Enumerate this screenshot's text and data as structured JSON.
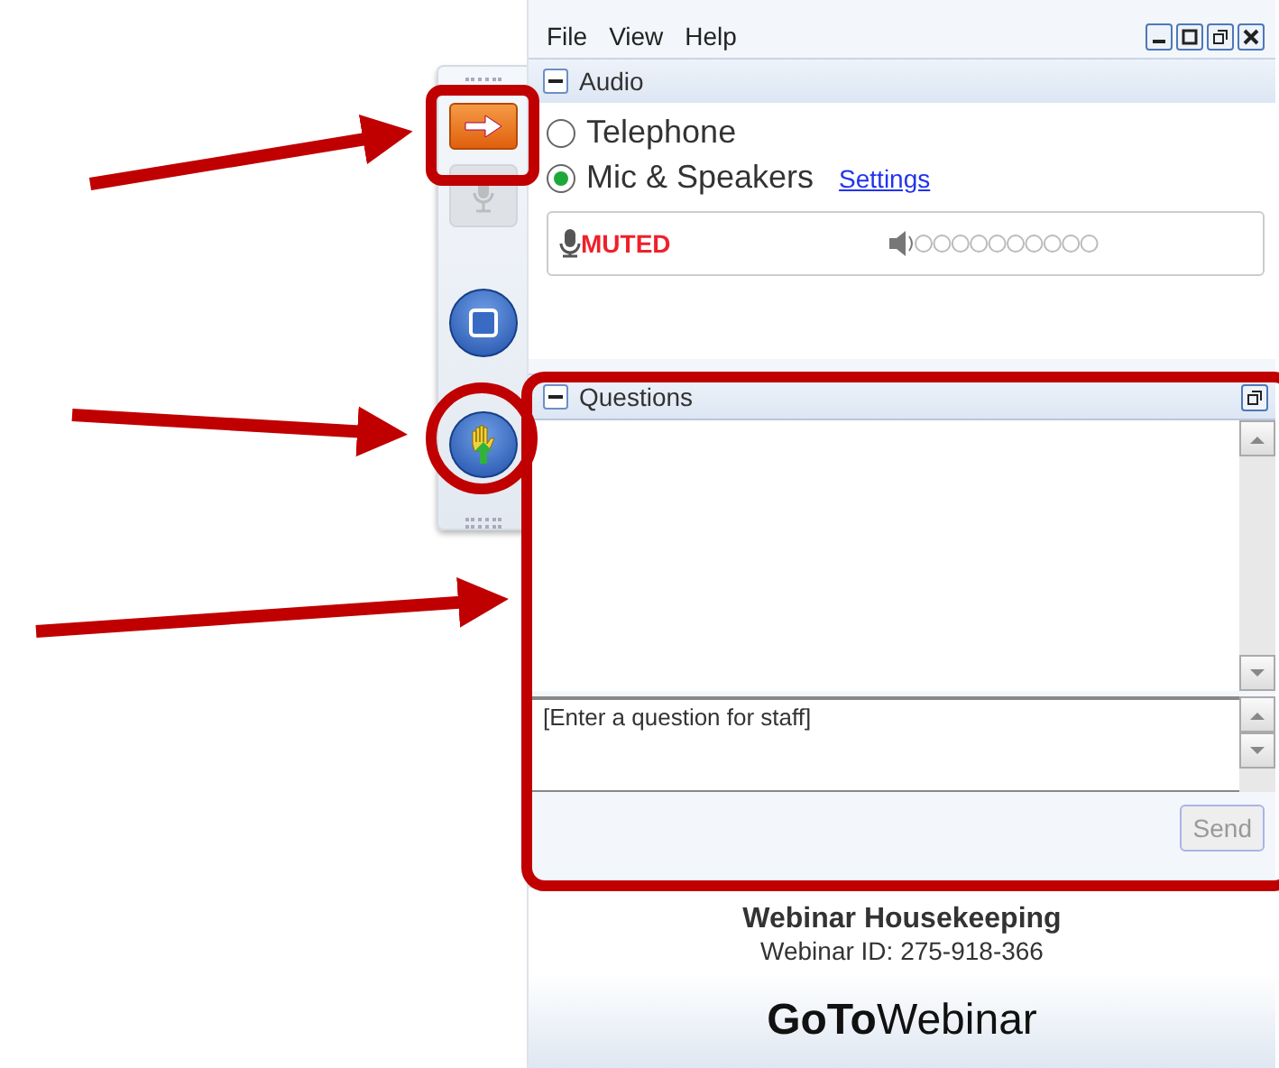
{
  "menu": [
    "File",
    "View",
    "Help"
  ],
  "side_tools": [
    {
      "kind": "exit",
      "disabled": false
    },
    {
      "kind": "mic",
      "disabled": true
    },
    {
      "kind": "stop",
      "disabled": false
    },
    {
      "kind": "hand",
      "disabled": false
    }
  ],
  "audio": {
    "title": "Audio",
    "options": [
      {
        "label": "Telephone",
        "selected": false
      },
      {
        "label": "Mic & Speakers",
        "selected": true
      }
    ],
    "settings_link": "Settings",
    "mic_status": "MUTED"
  },
  "questions": {
    "title": "Questions",
    "placeholder": "[Enter a question for staff]",
    "send": "Send",
    "send_disabled": true
  },
  "footer": {
    "title": "Webinar Housekeeping",
    "webinar_id": "Webinar ID: 275-918-366",
    "brand_bold": "GoTo",
    "brand_light": "Webinar"
  }
}
